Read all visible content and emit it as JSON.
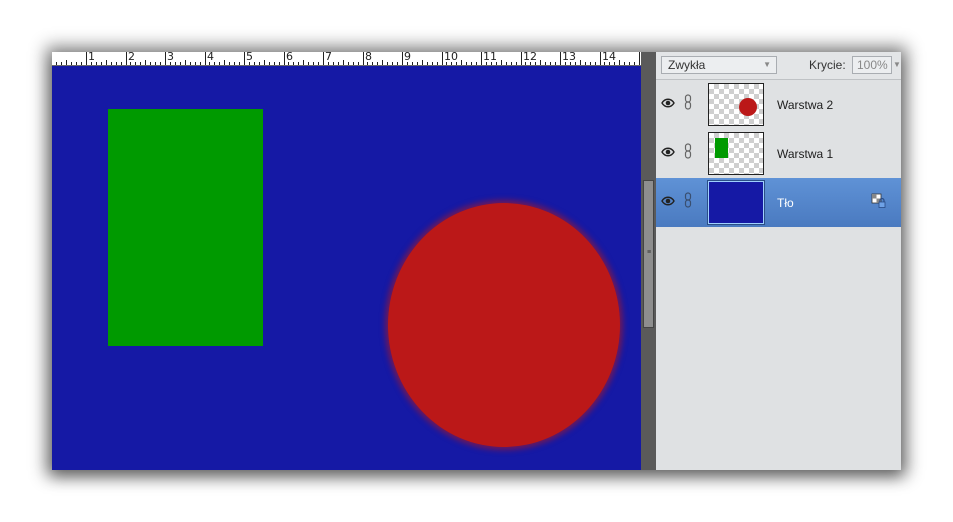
{
  "ruler": {
    "labels": [
      "1",
      "2",
      "3",
      "4",
      "5",
      "6",
      "7",
      "8",
      "9",
      "10",
      "11",
      "12",
      "13",
      "14",
      "1"
    ]
  },
  "canvas": {
    "background_color": "#1519a5",
    "shapes": [
      {
        "name": "green-rectangle",
        "color": "#009a00"
      },
      {
        "name": "red-circle",
        "color": "#bb1818"
      }
    ]
  },
  "layers_panel": {
    "blend_mode": "Zwykła",
    "opacity_label": "Krycie:",
    "opacity_value": "100%",
    "layers": [
      {
        "name": "Warstwa 2",
        "thumbnail": "red-dot-on-transparent",
        "selected": false
      },
      {
        "name": "Warstwa 1",
        "thumbnail": "green-rect-on-transparent",
        "selected": false
      },
      {
        "name": "Tło",
        "thumbnail": "solid-blue",
        "selected": true,
        "locked": true
      }
    ]
  },
  "colors": {
    "selection": "#5a8ad0",
    "panel_bg": "#dfe1e3"
  }
}
